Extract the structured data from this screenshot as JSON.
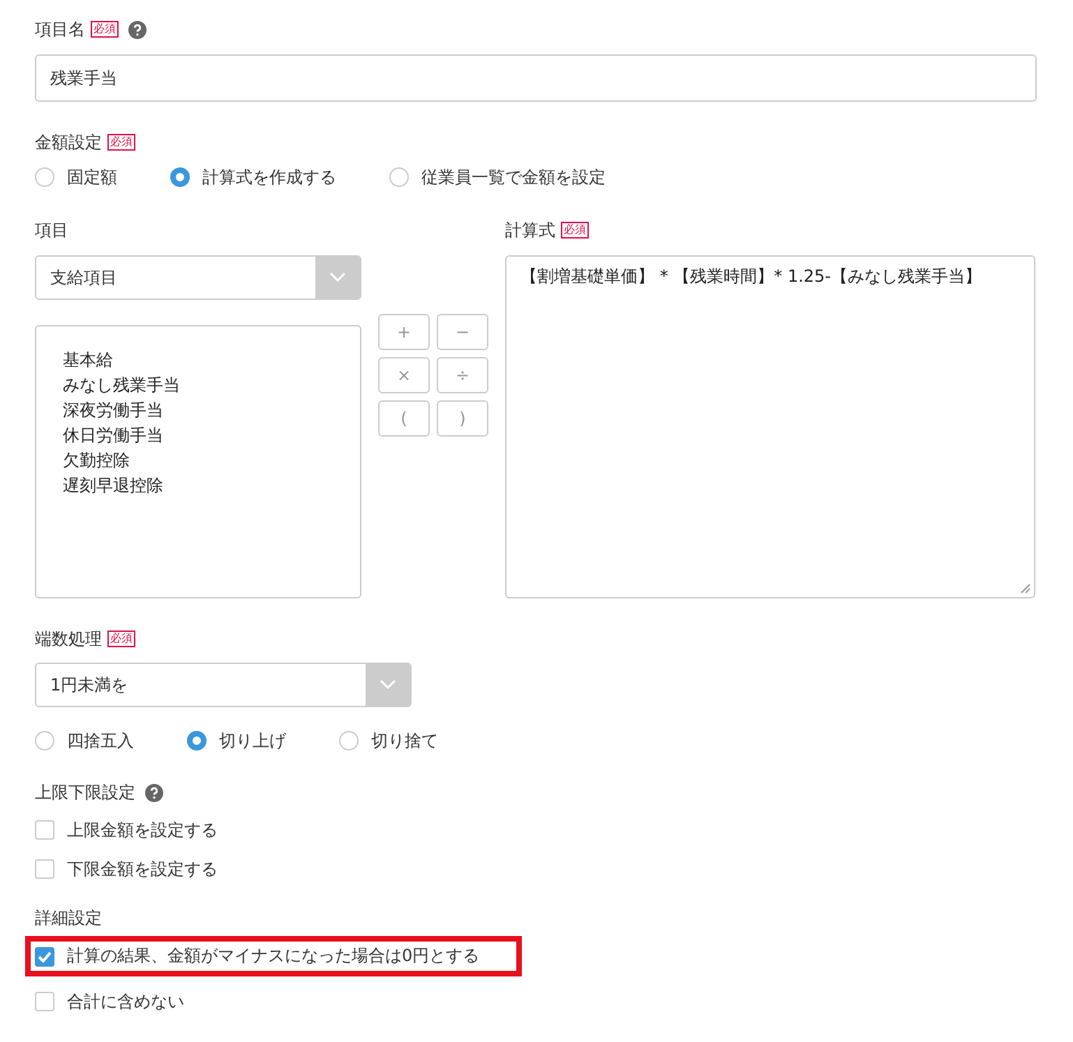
{
  "name_field": {
    "label": "項目名",
    "required": "必須",
    "value": "残業手当"
  },
  "amount_setting": {
    "label": "金額設定",
    "required": "必須",
    "options": [
      {
        "label": "固定額",
        "selected": false
      },
      {
        "label": "計算式を作成する",
        "selected": true
      },
      {
        "label": "従業員一覧で金額を設定",
        "selected": false
      }
    ]
  },
  "items": {
    "label": "項目",
    "select_value": "支給項目",
    "list": [
      "基本給",
      "みなし残業手当",
      "深夜労働手当",
      "休日労働手当",
      "欠勤控除",
      "遅刻早退控除"
    ]
  },
  "operators": [
    "+",
    "−",
    "×",
    "÷",
    "(",
    ")"
  ],
  "formula": {
    "label": "計算式",
    "required": "必須",
    "value": "【割増基礎単価】 * 【残業時間】* 1.25-【みなし残業手当】"
  },
  "rounding": {
    "label": "端数処理",
    "required": "必須",
    "select_value": "1円未満を",
    "options": [
      {
        "label": "四捨五入",
        "selected": false
      },
      {
        "label": "切り上げ",
        "selected": true
      },
      {
        "label": "切り捨て",
        "selected": false
      }
    ]
  },
  "limits": {
    "label": "上限下限設定",
    "options": [
      {
        "label": "上限金額を設定する",
        "checked": false
      },
      {
        "label": "下限金額を設定する",
        "checked": false
      }
    ]
  },
  "details": {
    "label": "詳細設定",
    "options": [
      {
        "label": "計算の結果、金額がマイナスになった場合は0円とする",
        "checked": true,
        "highlighted": true
      },
      {
        "label": "合計に含めない",
        "checked": false,
        "highlighted": false
      }
    ]
  }
}
